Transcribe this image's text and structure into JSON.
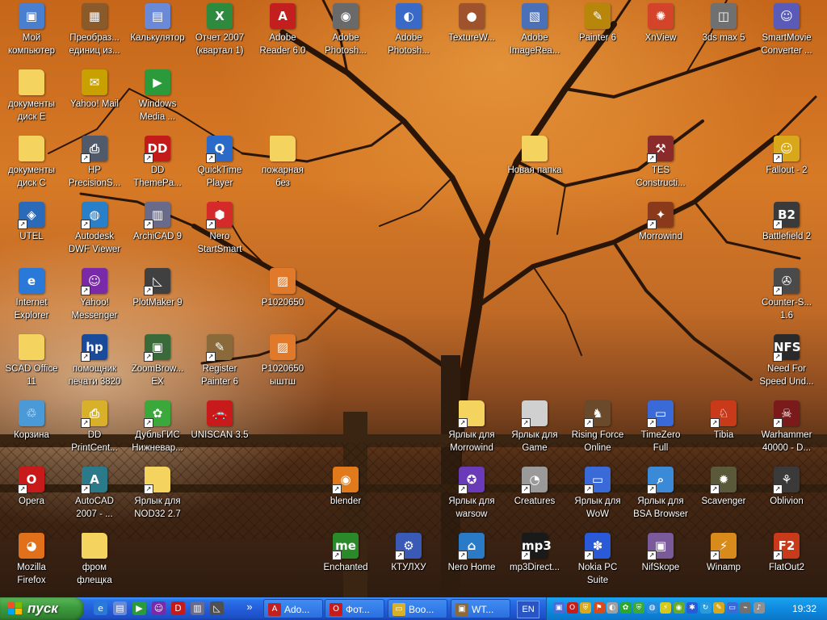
{
  "desktop": {
    "colors": {
      "sky": "#d77a26",
      "ground": "#2e1c10",
      "label_text": "#ffffff"
    },
    "icons": [
      {
        "label": "Мой\nкомпьютер",
        "icon": "my-computer-icon",
        "color": "#4a7fd0",
        "glyph": "▣",
        "shortcut": false
      },
      {
        "label": "Преобраз...\nединиц из...",
        "icon": "converter-icon",
        "color": "#8a5a2a",
        "glyph": "▦",
        "shortcut": false
      },
      {
        "label": "Калькулятор",
        "icon": "calculator-icon",
        "color": "#6a8ad8",
        "glyph": "▤",
        "shortcut": false
      },
      {
        "label": "Отчет 2007\n(квартал 1)",
        "icon": "excel-icon",
        "color": "#2e8b3e",
        "glyph": "X",
        "shortcut": false
      },
      {
        "label": "Adobe\nReader 6.0",
        "icon": "adobe-reader-icon",
        "color": "#c41f1f",
        "glyph": "A",
        "shortcut": false
      },
      {
        "label": "Adobe\nPhotosh...",
        "icon": "photoshop-eye-icon",
        "color": "#6a6a6a",
        "glyph": "◉",
        "shortcut": false
      },
      {
        "label": "Adobe\nPhotosh...",
        "icon": "photoshop-feather-icon",
        "color": "#3a6ac8",
        "glyph": "◐",
        "shortcut": false
      },
      {
        "label": "TextureW...",
        "icon": "texture-icon",
        "color": "#a0522d",
        "glyph": "●",
        "shortcut": false
      },
      {
        "label": "Adobe\nImageRea...",
        "icon": "imageready-icon",
        "color": "#4a70b8",
        "glyph": "▧",
        "shortcut": false
      },
      {
        "label": "Painter 6",
        "icon": "painter-icon",
        "color": "#b8860b",
        "glyph": "✎",
        "shortcut": false
      },
      {
        "label": "XnView",
        "icon": "xnview-icon",
        "color": "#d4442a",
        "glyph": "✺",
        "shortcut": false
      },
      {
        "label": "3ds max 5",
        "icon": "3dsmax-icon",
        "color": "#707070",
        "glyph": "◫",
        "shortcut": false
      },
      {
        "label": "SmartMovie\nConverter ...",
        "icon": "smartmovie-icon",
        "color": "#5a5ab8",
        "glyph": "☺",
        "shortcut": false
      },
      {
        "label": "документы\nдиск E",
        "icon": "folder-icon",
        "color": "#f4d35e",
        "glyph": "",
        "shortcut": false
      },
      {
        "label": "Yahoo! Mail",
        "icon": "yahoo-mail-icon",
        "color": "#c8a000",
        "glyph": "✉",
        "shortcut": false
      },
      {
        "label": "Windows\nMedia ...",
        "icon": "windows-media-icon",
        "color": "#2a9a3a",
        "glyph": "▶",
        "shortcut": false
      },
      {
        "label": "документы\nдиск C",
        "icon": "folder-icon",
        "color": "#f4d35e",
        "glyph": "",
        "shortcut": false
      },
      {
        "label": "HP\nPrecisionS...",
        "icon": "hp-scanner-icon",
        "color": "#505a6a",
        "glyph": "⎙",
        "shortcut": true
      },
      {
        "label": "DD\nThemePa...",
        "icon": "dd-themepack-icon",
        "color": "#c41a1a",
        "glyph": "DD",
        "shortcut": true
      },
      {
        "label": "QuickTime\nPlayer",
        "icon": "quicktime-icon",
        "color": "#2a6ac8",
        "glyph": "Q",
        "shortcut": true
      },
      {
        "label": "пожарная\nбез",
        "icon": "folder-icon",
        "color": "#f4d35e",
        "glyph": "",
        "shortcut": false
      },
      {
        "label": "Новая папка",
        "icon": "folder-icon",
        "color": "#f4d35e",
        "glyph": "",
        "shortcut": false
      },
      {
        "label": "TES\nConstructi...",
        "icon": "tes-construction-icon",
        "color": "#8a2a2a",
        "glyph": "⚒",
        "shortcut": true
      },
      {
        "label": "Fallout - 2",
        "icon": "fallout-icon",
        "color": "#d8a81a",
        "glyph": "☺",
        "shortcut": true
      },
      {
        "label": "UTEL",
        "icon": "utel-network-icon",
        "color": "#2a6ab8",
        "glyph": "◈",
        "shortcut": true
      },
      {
        "label": "Autodesk\nDWF Viewer",
        "icon": "autodesk-dwf-icon",
        "color": "#2a80c8",
        "glyph": "◍",
        "shortcut": true
      },
      {
        "label": "ArchiCAD 9",
        "icon": "archicad-icon",
        "color": "#6a6a8a",
        "glyph": "▥",
        "shortcut": true
      },
      {
        "label": "Nero\nStartSmart",
        "icon": "nero-icon",
        "color": "#d42a2a",
        "glyph": "⬢",
        "shortcut": true
      },
      {
        "label": "Morrowind",
        "icon": "morrowind-icon",
        "color": "#8a3a1a",
        "glyph": "✦",
        "shortcut": true
      },
      {
        "label": "Battlefield 2",
        "icon": "battlefield-icon",
        "color": "#3a3a3a",
        "glyph": "B2",
        "shortcut": true
      },
      {
        "label": "Internet\nExplorer",
        "icon": "internet-explorer-icon",
        "color": "#2a78d8",
        "glyph": "e",
        "shortcut": false
      },
      {
        "label": "Yahoo!\nMessenger",
        "icon": "yahoo-messenger-icon",
        "color": "#7a2aa8",
        "glyph": "☺",
        "shortcut": true
      },
      {
        "label": "PlotMaker 9",
        "icon": "plotmaker-icon",
        "color": "#404040",
        "glyph": "◺",
        "shortcut": true
      },
      {
        "label": "P1020650",
        "icon": "image-file-icon",
        "color": "#e07a2a",
        "glyph": "▨",
        "shortcut": false
      },
      {
        "label": "Counter-S...\n1.6",
        "icon": "counter-strike-icon",
        "color": "#4a4a4a",
        "glyph": "✇",
        "shortcut": true
      },
      {
        "label": "SCAD Office\n11",
        "icon": "folder-icon",
        "color": "#f4d35e",
        "glyph": "",
        "shortcut": false
      },
      {
        "label": "помощник\nпечати 3820",
        "icon": "hp-print-icon",
        "color": "#1a4a9a",
        "glyph": "hp",
        "shortcut": true
      },
      {
        "label": "ZoomBrow...\nEX",
        "icon": "zoombrowser-icon",
        "color": "#3a6a3a",
        "glyph": "▣",
        "shortcut": true
      },
      {
        "label": "Register\nPainter 6",
        "icon": "register-painter-icon",
        "color": "#8a6a3a",
        "glyph": "✎",
        "shortcut": true
      },
      {
        "label": "P1020650\nыштш",
        "icon": "image-file-icon",
        "color": "#e07a2a",
        "glyph": "▨",
        "shortcut": false
      },
      {
        "label": "Need For\nSpeed Und...",
        "icon": "nfs-icon",
        "color": "#2a2a2a",
        "glyph": "NFS",
        "shortcut": true
      },
      {
        "label": "Корзина",
        "icon": "recycle-bin-icon",
        "color": "#4a9ad8",
        "glyph": "♲",
        "shortcut": false
      },
      {
        "label": "DD\nPrintCent...",
        "icon": "dd-printcenter-icon",
        "color": "#d8b02a",
        "glyph": "⎙",
        "shortcut": true
      },
      {
        "label": "ДубльГИС\nНижневар...",
        "icon": "dublgis-icon",
        "color": "#3aa83a",
        "glyph": "✿",
        "shortcut": true
      },
      {
        "label": "UNISCAN 3.5",
        "icon": "uniscan-car-icon",
        "color": "#c81a1a",
        "glyph": "🚗",
        "shortcut": false
      },
      {
        "label": "Ярлык для\nMorrowind",
        "icon": "folder-icon",
        "color": "#f4d35e",
        "glyph": "",
        "shortcut": true
      },
      {
        "label": "Ярлык для\nGame",
        "icon": "blank-file-icon",
        "color": "#d0d0d0",
        "glyph": "",
        "shortcut": true
      },
      {
        "label": "Rising Force\nOnline",
        "icon": "rising-force-icon",
        "color": "#6a4a2a",
        "glyph": "♞",
        "shortcut": true
      },
      {
        "label": "TimeZero\nFull",
        "icon": "timezero-window-icon",
        "color": "#3a6ad8",
        "glyph": "▭",
        "shortcut": true
      },
      {
        "label": "Tibia",
        "icon": "tibia-icon",
        "color": "#c83a1a",
        "glyph": "♘",
        "shortcut": true
      },
      {
        "label": "Warhammer\n40000 - D...",
        "icon": "warhammer-skull-icon",
        "color": "#7a1a1a",
        "glyph": "☠",
        "shortcut": true
      },
      {
        "label": "Opera",
        "icon": "opera-icon",
        "color": "#c81a1a",
        "glyph": "O",
        "shortcut": true
      },
      {
        "label": "AutoCAD\n2007 - ...",
        "icon": "autocad-icon",
        "color": "#2a7a8a",
        "glyph": "A",
        "shortcut": true
      },
      {
        "label": "Ярлык для\nNOD32 2.7",
        "icon": "folder-icon",
        "color": "#f4d35e",
        "glyph": "",
        "shortcut": true
      },
      {
        "label": "blender",
        "icon": "blender-icon",
        "color": "#e07a1a",
        "glyph": "◉",
        "shortcut": true
      },
      {
        "label": "Ярлык для\nwarsow",
        "icon": "warsow-icon",
        "color": "#6a3ab8",
        "glyph": "✪",
        "shortcut": true
      },
      {
        "label": "Creatures",
        "icon": "creatures-icon",
        "color": "#9a9a9a",
        "glyph": "◔",
        "shortcut": true
      },
      {
        "label": "Ярлык для\nWoW",
        "icon": "wow-window-icon",
        "color": "#3a6ad8",
        "glyph": "▭",
        "shortcut": true
      },
      {
        "label": "Ярлык для\nBSA Browser",
        "icon": "bsa-browser-icon",
        "color": "#3a8ad8",
        "glyph": "⌕",
        "shortcut": true
      },
      {
        "label": "Scavenger",
        "icon": "scavenger-icon",
        "color": "#5a5a3a",
        "glyph": "✹",
        "shortcut": true
      },
      {
        "label": "Oblivion",
        "icon": "oblivion-icon",
        "color": "#3a3a3a",
        "glyph": "⚘",
        "shortcut": true
      },
      {
        "label": "Mozilla\nFirefox",
        "icon": "firefox-icon",
        "color": "#e0701a",
        "glyph": "◕",
        "shortcut": false
      },
      {
        "label": "фром\nфлещка",
        "icon": "folder-icon",
        "color": "#f4d35e",
        "glyph": "",
        "shortcut": false
      },
      {
        "label": "Enchanted",
        "icon": "enchanted-icon",
        "color": "#2a8a2a",
        "glyph": "me",
        "shortcut": true
      },
      {
        "label": "КТУЛХУ",
        "icon": "gear-icon",
        "color": "#3a5ab8",
        "glyph": "⚙",
        "shortcut": true
      },
      {
        "label": "Nero Home",
        "icon": "nero-home-icon",
        "color": "#2a7ac8",
        "glyph": "⌂",
        "shortcut": true
      },
      {
        "label": "mp3Direct...",
        "icon": "mp3directcut-icon",
        "color": "#1a1a1a",
        "glyph": "mp3",
        "shortcut": true
      },
      {
        "label": "Nokia PC\nSuite",
        "icon": "nokia-pc-suite-icon",
        "color": "#2a5ad8",
        "glyph": "✽",
        "shortcut": true
      },
      {
        "label": "NifSkope",
        "icon": "nifskope-icon",
        "color": "#7a5a9a",
        "glyph": "▣",
        "shortcut": true
      },
      {
        "label": "Winamp",
        "icon": "winamp-icon",
        "color": "#d88a1a",
        "glyph": "⚡",
        "shortcut": true
      },
      {
        "label": "FlatOut2",
        "icon": "flatout-icon",
        "color": "#c83a1a",
        "glyph": "F2",
        "shortcut": true
      }
    ]
  },
  "taskbar": {
    "start_label": "пуск",
    "quick_launch": [
      {
        "icon": "ie-quicklaunch-icon",
        "color": "#2a78d8",
        "glyph": "e"
      },
      {
        "icon": "calculator-quicklaunch-icon",
        "color": "#6a8ad8",
        "glyph": "▤"
      },
      {
        "icon": "media-quicklaunch-icon",
        "color": "#2a9a3a",
        "glyph": "▶"
      },
      {
        "icon": "yahoo-quicklaunch-icon",
        "color": "#7a2aa8",
        "glyph": "☺"
      },
      {
        "icon": "dd-quicklaunch-icon",
        "color": "#c41a1a",
        "glyph": "D"
      },
      {
        "icon": "archicad-quicklaunch-icon",
        "color": "#6a6a8a",
        "glyph": "▥"
      },
      {
        "icon": "plotmaker-quicklaunch-icon",
        "color": "#505050",
        "glyph": "◺"
      }
    ],
    "overflow_label": "»",
    "tasks": [
      {
        "label": "Ado...",
        "icon": "adobe-task-icon",
        "color": "#c41f1f",
        "glyph": "A"
      },
      {
        "label": "Фот...",
        "icon": "opera-task-icon",
        "color": "#c81a1a",
        "glyph": "O"
      },
      {
        "label": "Boo...",
        "icon": "folder-task-icon",
        "color": "#d8b02a",
        "glyph": "▭"
      },
      {
        "label": "WT...",
        "icon": "window-task-icon",
        "color": "#8a6a3a",
        "glyph": "▣"
      }
    ],
    "language": "EN",
    "tray_icons": [
      {
        "icon": "network-tray-icon",
        "color": "#4a6ad8",
        "glyph": "▣"
      },
      {
        "icon": "opera-tray-icon",
        "color": "#c81a1a",
        "glyph": "O"
      },
      {
        "icon": "shield-tray-icon",
        "color": "#d8a81a",
        "glyph": "⛨"
      },
      {
        "icon": "flag-tray-icon",
        "color": "#d84a1a",
        "glyph": "⚑"
      },
      {
        "icon": "volume-tray-icon",
        "color": "#a0a0a0",
        "glyph": "◐"
      },
      {
        "icon": "qip-flower-tray-icon",
        "color": "#2aa82a",
        "glyph": "✿"
      },
      {
        "icon": "shield-green-tray-icon",
        "color": "#3aa83a",
        "glyph": "⛨"
      },
      {
        "icon": "globe-tray-icon",
        "color": "#2a8ad8",
        "glyph": "◍"
      },
      {
        "icon": "power-tray-icon",
        "color": "#d8c81a",
        "glyph": "⚡"
      },
      {
        "icon": "nvidia-tray-icon",
        "color": "#6aa82a",
        "glyph": "◉"
      },
      {
        "icon": "bluetooth-tray-icon",
        "color": "#2a5ad8",
        "glyph": "✱"
      },
      {
        "icon": "update-tray-icon",
        "color": "#2a9ad8",
        "glyph": "↻"
      },
      {
        "icon": "pen-tray-icon",
        "color": "#d8a81a",
        "glyph": "✎"
      },
      {
        "icon": "display-tray-icon",
        "color": "#3a6ad8",
        "glyph": "▭"
      },
      {
        "icon": "usb-tray-icon",
        "color": "#707070",
        "glyph": "⌁"
      },
      {
        "icon": "speaker-tray-icon",
        "color": "#909090",
        "glyph": "♪"
      }
    ],
    "clock": "19:32"
  }
}
